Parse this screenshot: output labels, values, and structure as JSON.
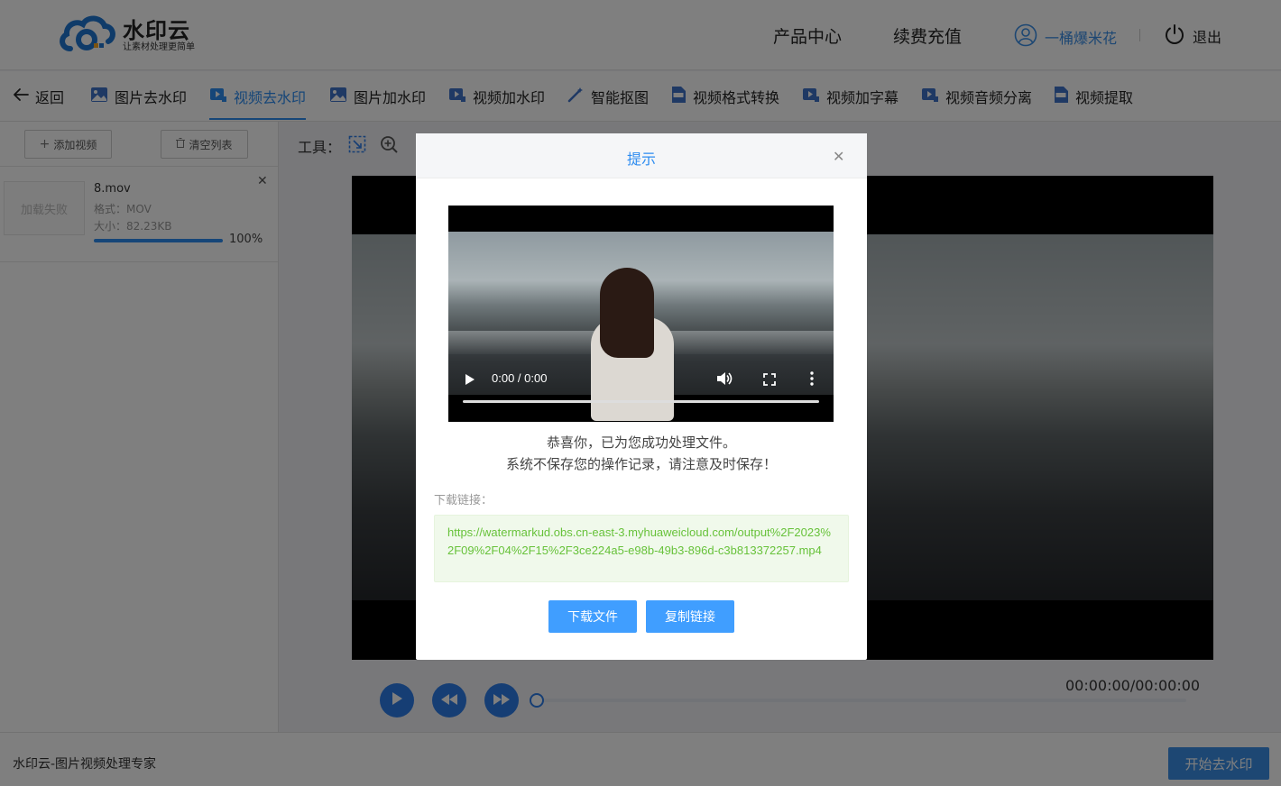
{
  "header": {
    "logo_name": "水印云",
    "logo_slogan": "让素材处理更简单",
    "nav": [
      "产品中心",
      "续费充值"
    ],
    "username": "一桶爆米花",
    "logout": "退出"
  },
  "toolbar": {
    "back": "返回",
    "tabs": [
      {
        "label": "图片去水印",
        "icon": "image-icon"
      },
      {
        "label": "视频去水印",
        "icon": "video-icon",
        "active": true
      },
      {
        "label": "图片加水印",
        "icon": "image-icon"
      },
      {
        "label": "视频加水印",
        "icon": "video-icon"
      },
      {
        "label": "智能抠图",
        "icon": "magic-wand-icon"
      },
      {
        "label": "视频格式转换",
        "icon": "mp4-file-icon"
      },
      {
        "label": "视频加字幕",
        "icon": "video-icon"
      },
      {
        "label": "视频音频分离",
        "icon": "video-icon"
      },
      {
        "label": "视频提取",
        "icon": "mp4-file-icon"
      }
    ]
  },
  "left_panel": {
    "add_video": "添加视频",
    "clear_list": "清空列表",
    "file": {
      "thumb_text": "加载失败",
      "name": "8.mov",
      "format": "格式：MOV",
      "size": "大小：82.23KB",
      "progress_percent": 100,
      "progress_label": "100%"
    }
  },
  "main": {
    "tools_label": "工具：",
    "timecode": "00:00:00/00:00:00"
  },
  "footer": {
    "text": "水印云-图片视频处理专家",
    "start_button": "开始去水印"
  },
  "modal": {
    "title": "提示",
    "player_time": "0:00 / 0:00",
    "message_line1": "恭喜你，已为您成功处理文件。",
    "message_line2": "系统不保存您的操作记录，请注意及时保存！",
    "download_label": "下载链接：",
    "download_url": "https://watermarkud.obs.cn-east-3.myhuaweicloud.com/output%2F2023%2F09%2F04%2F15%2F3ce224a5-e98b-49b3-896d-c3b813372257.mp4",
    "download_button": "下载文件",
    "copy_button": "复制链接"
  },
  "colors": {
    "accent": "#2d8cf0",
    "button": "#409eff",
    "success_text": "#67c23a",
    "success_bg": "#f0f9eb"
  }
}
